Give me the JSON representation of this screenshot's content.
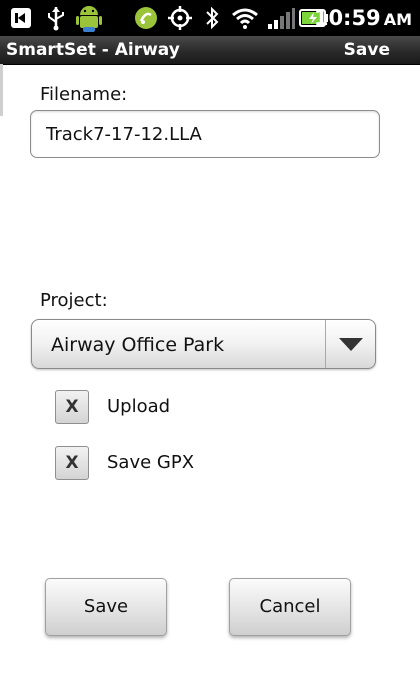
{
  "status_bar": {
    "time": "10:59",
    "ampm": "AM",
    "icons": [
      "back-icon",
      "usb-icon",
      "android-debug-icon",
      "location-icon",
      "gps-icon",
      "bluetooth-icon",
      "wifi-icon",
      "signal-icon",
      "battery-charging-icon"
    ]
  },
  "title_bar": {
    "title": "SmartSet - Airway",
    "save_label": "Save"
  },
  "form": {
    "filename_label": "Filename:",
    "filename_value": "Track7-17-12.LLA",
    "project_label": "Project:",
    "project_value": "Airway Office Park",
    "upload_mark": "X",
    "upload_label": "Upload",
    "gpx_mark": "X",
    "gpx_label": "Save GPX"
  },
  "buttons": {
    "save": "Save",
    "cancel": "Cancel"
  },
  "colors": {
    "status_bar_bg": "#000000",
    "title_bar_bg": "#2a2a2a",
    "battery_green": "#7cd43a",
    "wifi_green": "#ffffff"
  }
}
